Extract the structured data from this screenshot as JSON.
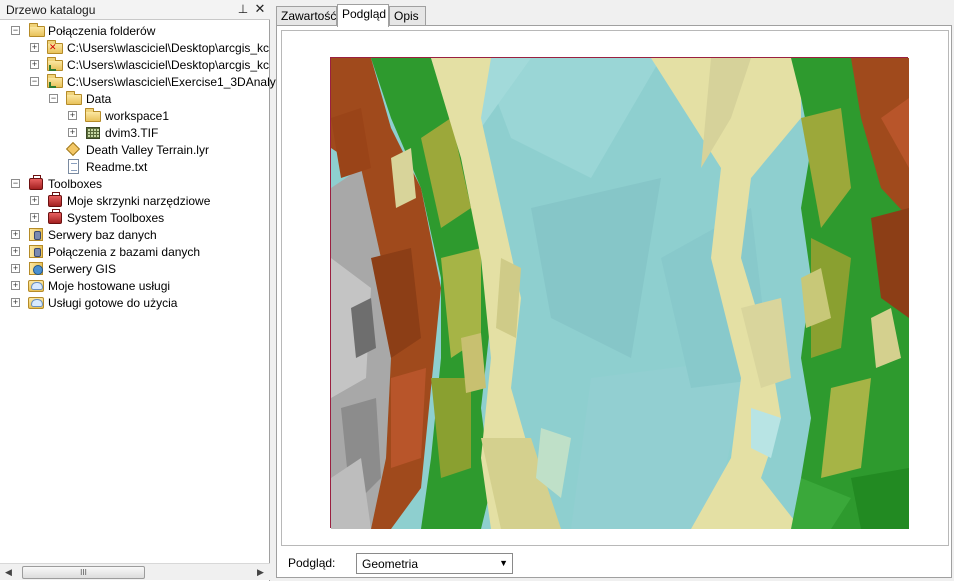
{
  "catalog": {
    "title": "Drzewo katalogu",
    "pin_icon": "pin-icon",
    "close_icon": "close-icon",
    "items": [
      {
        "label": "Połączenia folderów",
        "icon": "folder-connections-icon",
        "state": "expanded"
      },
      {
        "label": "C:\\Users\\wlasciciel\\Desktop\\arcgis_kc",
        "icon": "folder-error-icon",
        "state": "collapsed"
      },
      {
        "label": "C:\\Users\\wlasciciel\\Desktop\\arcgis_kc",
        "icon": "folder-link-icon",
        "state": "collapsed"
      },
      {
        "label": "C:\\Users\\wlasciciel\\Exercise1_3DAnaly",
        "icon": "folder-link-icon",
        "state": "expanded"
      },
      {
        "label": "Data",
        "icon": "folder-icon",
        "state": "expanded"
      },
      {
        "label": "workspace1",
        "icon": "folder-icon",
        "state": "collapsed"
      },
      {
        "label": "dvim3.TIF",
        "icon": "raster-icon",
        "state": "collapsed"
      },
      {
        "label": "Death Valley Terrain.lyr",
        "icon": "layer-icon",
        "state": "none"
      },
      {
        "label": "Readme.txt",
        "icon": "text-file-icon",
        "state": "none"
      },
      {
        "label": "Toolboxes",
        "icon": "toolbox-icon",
        "state": "expanded"
      },
      {
        "label": "Moje skrzynki narzędziowe",
        "icon": "toolbox-icon",
        "state": "collapsed"
      },
      {
        "label": "System Toolboxes",
        "icon": "toolbox-icon",
        "state": "collapsed"
      },
      {
        "label": "Serwery baz danych",
        "icon": "database-server-icon",
        "state": "collapsed"
      },
      {
        "label": "Połączenia z bazami danych",
        "icon": "database-connection-icon",
        "state": "collapsed"
      },
      {
        "label": "Serwery GIS",
        "icon": "gis-server-icon",
        "state": "collapsed"
      },
      {
        "label": "Moje hostowane usługi",
        "icon": "hosted-services-icon",
        "state": "collapsed"
      },
      {
        "label": "Usługi gotowe do użycia",
        "icon": "ready-services-icon",
        "state": "collapsed"
      }
    ],
    "scrollbar": {
      "thumb_grip": "III"
    }
  },
  "tabs": [
    {
      "label": "Zawartość",
      "active": false
    },
    {
      "label": "Podgląd",
      "active": true
    },
    {
      "label": "Opis",
      "active": false
    }
  ],
  "preview": {
    "label": "Podgląd:",
    "select_value": "Geometria",
    "dropdown_icon": "chevron-down-icon",
    "image_name": "terrain-preview",
    "colors": {
      "water": "#8ecfcf",
      "sand": "#e6e2a8",
      "green": "#2e9a2e",
      "olive": "#9ca83a",
      "brown": "#a04a1c",
      "gray": "#a8a8a8",
      "border": "#9a2040"
    }
  }
}
